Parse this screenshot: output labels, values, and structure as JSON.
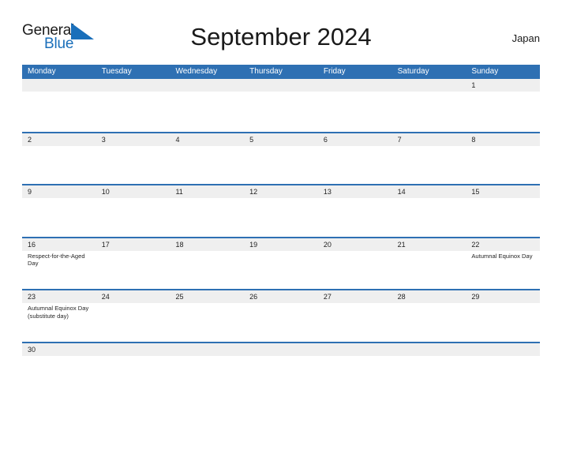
{
  "brand": {
    "name_part1": "General",
    "name_part2": "Blue",
    "flag_icon": "blue-triangle-flag-icon",
    "accent_color": "#1a6fba"
  },
  "header": {
    "title": "September 2024",
    "country": "Japan"
  },
  "calendar": {
    "header_bg_color": "#2e70b3",
    "row_divider_color": "#2e70b3",
    "day_band_color": "#efefef",
    "weekdays": [
      "Monday",
      "Tuesday",
      "Wednesday",
      "Thursday",
      "Friday",
      "Saturday",
      "Sunday"
    ],
    "weeks": [
      [
        {
          "day": "",
          "events": []
        },
        {
          "day": "",
          "events": []
        },
        {
          "day": "",
          "events": []
        },
        {
          "day": "",
          "events": []
        },
        {
          "day": "",
          "events": []
        },
        {
          "day": "",
          "events": []
        },
        {
          "day": "1",
          "events": []
        }
      ],
      [
        {
          "day": "2",
          "events": []
        },
        {
          "day": "3",
          "events": []
        },
        {
          "day": "4",
          "events": []
        },
        {
          "day": "5",
          "events": []
        },
        {
          "day": "6",
          "events": []
        },
        {
          "day": "7",
          "events": []
        },
        {
          "day": "8",
          "events": []
        }
      ],
      [
        {
          "day": "9",
          "events": []
        },
        {
          "day": "10",
          "events": []
        },
        {
          "day": "11",
          "events": []
        },
        {
          "day": "12",
          "events": []
        },
        {
          "day": "13",
          "events": []
        },
        {
          "day": "14",
          "events": []
        },
        {
          "day": "15",
          "events": []
        }
      ],
      [
        {
          "day": "16",
          "events": [
            "Respect-for-the-Aged Day"
          ]
        },
        {
          "day": "17",
          "events": []
        },
        {
          "day": "18",
          "events": []
        },
        {
          "day": "19",
          "events": []
        },
        {
          "day": "20",
          "events": []
        },
        {
          "day": "21",
          "events": []
        },
        {
          "day": "22",
          "events": [
            "Autumnal Equinox Day"
          ]
        }
      ],
      [
        {
          "day": "23",
          "events": [
            "Autumnal Equinox Day (substitute day)"
          ]
        },
        {
          "day": "24",
          "events": []
        },
        {
          "day": "25",
          "events": []
        },
        {
          "day": "26",
          "events": []
        },
        {
          "day": "27",
          "events": []
        },
        {
          "day": "28",
          "events": []
        },
        {
          "day": "29",
          "events": []
        }
      ],
      [
        {
          "day": "30",
          "events": []
        },
        {
          "day": "",
          "events": []
        },
        {
          "day": "",
          "events": []
        },
        {
          "day": "",
          "events": []
        },
        {
          "day": "",
          "events": []
        },
        {
          "day": "",
          "events": []
        },
        {
          "day": "",
          "events": []
        }
      ]
    ]
  }
}
